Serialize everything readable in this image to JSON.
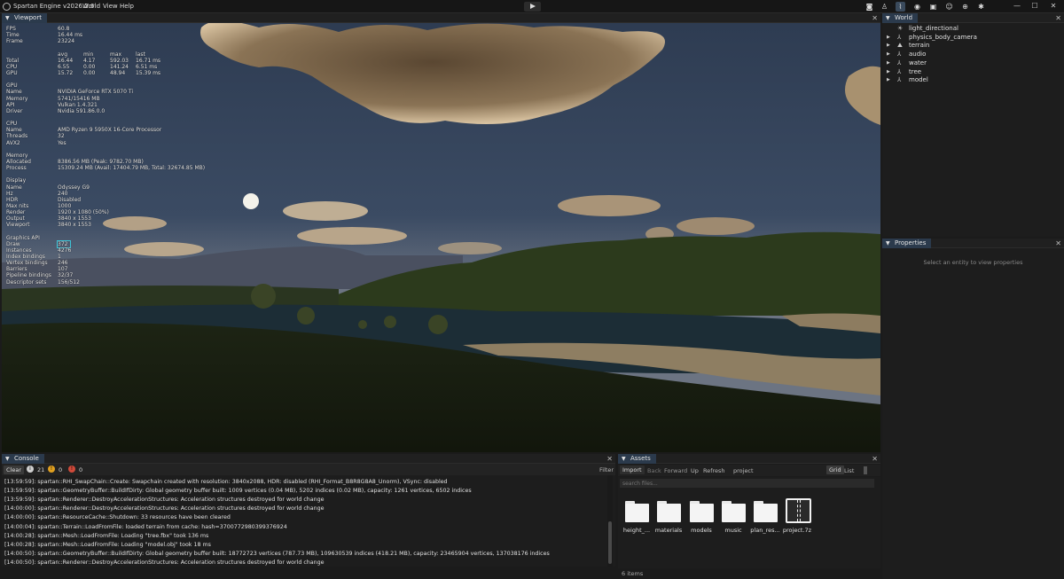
{
  "titlebar": {
    "app_title": "Spartan Engine v2026.2.6",
    "menus": [
      "World",
      "View",
      "Help"
    ]
  },
  "toolbar": {
    "icons": [
      "camera-icon",
      "person-icon",
      "chart-icon",
      "globe-icon",
      "image-icon",
      "robot-icon",
      "gamepad-icon",
      "gear-icon"
    ]
  },
  "window_controls": {
    "minimize": "—",
    "maximize": "☐",
    "close": "✕"
  },
  "viewport": {
    "tab": "Viewport",
    "stats_top": [
      [
        "FPS",
        "60.8"
      ],
      [
        "Time",
        "16.44 ms"
      ],
      [
        "Frame",
        "23224"
      ]
    ],
    "timing_header": [
      "avg",
      "min",
      "max",
      "last"
    ],
    "timing": [
      [
        "Total",
        "16.44",
        "4.17",
        "592.03",
        "16.71 ms"
      ],
      [
        "CPU",
        "6.55",
        "0.00",
        "141.24",
        "6.51 ms"
      ],
      [
        "GPU",
        "15.72",
        "0.00",
        "48.94",
        "15.39 ms"
      ]
    ],
    "gpu_section": [
      [
        "GPU",
        ""
      ],
      [
        "Name",
        "NVIDIA GeForce RTX 5070 Ti"
      ],
      [
        "Memory",
        "5741/15416 MB"
      ],
      [
        "API",
        "Vulkan 1.4.321"
      ],
      [
        "Driver",
        "Nvidia 591.86.0.0"
      ]
    ],
    "cpu_section": [
      [
        "CPU",
        ""
      ],
      [
        "Name",
        "AMD Ryzen 9 5950X 16-Core Processor"
      ],
      [
        "Threads",
        "32"
      ],
      [
        "AVX2",
        "Yes"
      ]
    ],
    "mem_section": [
      [
        "Memory",
        ""
      ],
      [
        "Allocated",
        "8386.56 MB (Peak: 9782.70 MB)"
      ],
      [
        "Process",
        "15309.24 MB (Avail: 17404.79 MB, Total: 32674.85 MB)"
      ]
    ],
    "display_section": [
      [
        "Display",
        ""
      ],
      [
        "Name",
        "Odyssey G9"
      ],
      [
        "Hz",
        "240"
      ],
      [
        "HDR",
        "Disabled"
      ],
      [
        "Max nits",
        "1000"
      ],
      [
        "Render",
        "1920 x 1080 (50%)"
      ],
      [
        "Output",
        "3840 x 1553"
      ],
      [
        "Viewport",
        "3840 x 1553"
      ]
    ],
    "graphics_section": [
      [
        "Graphics API",
        ""
      ],
      [
        "Draw",
        "372"
      ],
      [
        "Instances",
        "4276"
      ],
      [
        "Index bindings",
        "1"
      ],
      [
        "Vertex bindings",
        "246"
      ],
      [
        "Barriers",
        "107"
      ],
      [
        "Pipeline bindings",
        "32/37"
      ],
      [
        "Descriptor sets",
        "156/512"
      ]
    ]
  },
  "world": {
    "tab": "World",
    "items": [
      {
        "label": "light_directional",
        "icon": "sun-icon",
        "expandable": false
      },
      {
        "label": "physics_body_camera",
        "icon": "entity-icon",
        "expandable": true
      },
      {
        "label": "terrain",
        "icon": "terrain-icon",
        "expandable": true
      },
      {
        "label": "audio",
        "icon": "entity-icon",
        "expandable": true
      },
      {
        "label": "water",
        "icon": "entity-icon",
        "expandable": true
      },
      {
        "label": "tree",
        "icon": "entity-icon",
        "expandable": true
      },
      {
        "label": "model",
        "icon": "entity-icon",
        "expandable": true
      }
    ]
  },
  "properties": {
    "tab": "Properties",
    "empty_text": "Select an entity to view properties"
  },
  "console": {
    "tab": "Console",
    "clear_label": "Clear",
    "info_count": "21",
    "warning_count": "0",
    "error_count": "0",
    "filter_label": "Filter",
    "lines": [
      "[13:59:59]: spartan::RHI_SwapChain::Create: Swapchain created with resolution: 3840x2088, HDR: disabled (RHI_Format_B8R8G8A8_Unorm), VSync: disabled",
      "[13:59:59]: spartan::GeometryBuffer::BuildIfDirty: Global geometry buffer built: 1009 vertices (0.04 MB), 5202 indices (0.02 MB), capacity: 1261 vertices, 6502 indices",
      "[13:59:59]: spartan::Renderer::DestroyAccelerationStructures: Acceleration structures destroyed for world change",
      "[14:00:00]: spartan::Renderer::DestroyAccelerationStructures: Acceleration structures destroyed for world change",
      "[14:00:00]: spartan::ResourceCache::Shutdown: 33 resources have been cleared",
      "[14:00:04]: spartan::Terrain::LoadFromFile: loaded terrain from cache: hash=3700772980399376924",
      "[14:00:28]: spartan::Mesh::LoadFromFile: Loading \"tree.fbx\" took 136 ms",
      "[14:00:28]: spartan::Mesh::LoadFromFile: Loading \"model.obj\" took 18 ms",
      "[14:00:50]: spartan::GeometryBuffer::BuildIfDirty: Global geometry buffer built: 18772723 vertices (787.73 MB), 109630539 indices (418.21 MB), capacity: 23465904 vertices, 137038176 indices",
      "[14:00:50]: spartan::Renderer::DestroyAccelerationStructures: Acceleration structures destroyed for world change"
    ]
  },
  "assets": {
    "tab": "Assets",
    "toolbar": {
      "import": "Import",
      "back": "Back",
      "forward": "Forward",
      "up": "Up",
      "refresh": "Refresh",
      "path": "project",
      "grid": "Grid",
      "list": "List"
    },
    "search_placeholder": "search files...",
    "items": [
      {
        "label": "height_...",
        "type": "folder"
      },
      {
        "label": "materials",
        "type": "folder"
      },
      {
        "label": "models",
        "type": "folder"
      },
      {
        "label": "music",
        "type": "folder"
      },
      {
        "label": "plan_res...",
        "type": "folder"
      },
      {
        "label": "project.7z",
        "type": "archive"
      }
    ],
    "count_label": "6 items"
  },
  "colors": {
    "accent_tab": "#2b3a4c",
    "highlight": "#3cc3d6",
    "info": "#d0d0d0",
    "warning": "#e0a020",
    "error": "#d04a3a"
  }
}
